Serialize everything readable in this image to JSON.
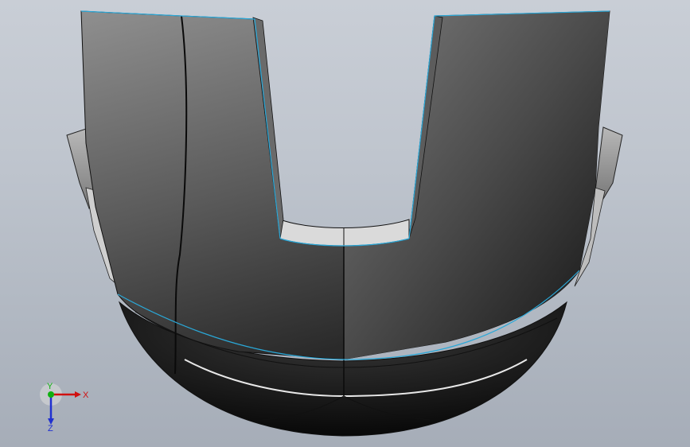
{
  "axis_triad": {
    "x_label": "X",
    "y_label": "Y",
    "z_label": "Z",
    "x_color": "#d01010",
    "y_color": "#10b010",
    "z_color": "#2030d0"
  },
  "colors": {
    "edge_highlight": "#2aa8d8",
    "body_dark": "#1e1e1e",
    "body_light": "#8a8a8a",
    "inner_face": "#d8d8d8"
  }
}
